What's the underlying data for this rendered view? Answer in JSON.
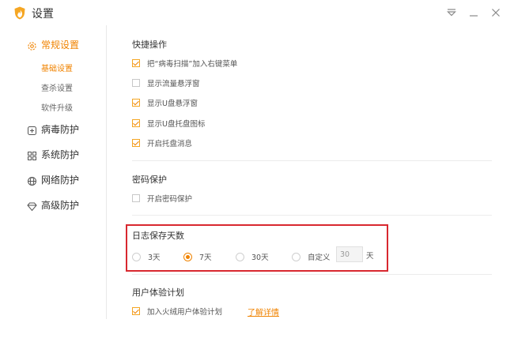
{
  "window": {
    "title": "设置",
    "controls": [
      "dropdown-icon",
      "minimize-icon",
      "close-icon"
    ]
  },
  "sidebar": {
    "items": [
      {
        "label": "常规设置",
        "icon": "gear-icon",
        "active": true,
        "subitems": [
          {
            "label": "基础设置",
            "active": true
          },
          {
            "label": "查杀设置",
            "active": false
          },
          {
            "label": "软件升级",
            "active": false
          }
        ]
      },
      {
        "label": "病毒防护",
        "icon": "plus-shield-icon",
        "active": false
      },
      {
        "label": "系统防护",
        "icon": "grid-icon",
        "active": false
      },
      {
        "label": "网络防护",
        "icon": "globe-icon",
        "active": false
      },
      {
        "label": "高级防护",
        "icon": "diamond-icon",
        "active": false
      }
    ]
  },
  "sections": {
    "shortcuts": {
      "title": "快捷操作",
      "options": [
        {
          "label": "把“病毒扫描”加入右键菜单",
          "checked": true
        },
        {
          "label": "显示流量悬浮窗",
          "checked": false
        },
        {
          "label": "显示U盘悬浮窗",
          "checked": true
        },
        {
          "label": "显示U盘托盘图标",
          "checked": true
        },
        {
          "label": "开启托盘消息",
          "checked": true
        }
      ]
    },
    "password": {
      "title": "密码保护",
      "options": [
        {
          "label": "开启密码保护",
          "checked": false
        }
      ]
    },
    "log_days": {
      "title": "日志保存天数",
      "options": [
        {
          "label": "3天",
          "checked": false
        },
        {
          "label": "7天",
          "checked": true
        },
        {
          "label": "30天",
          "checked": false
        },
        {
          "label": "自定义",
          "checked": false
        }
      ],
      "custom_value": "30",
      "unit": "天"
    },
    "ux_plan": {
      "title": "用户体验计划",
      "options": [
        {
          "label": "加入火绒用户体验计划",
          "checked": true
        }
      ],
      "link": "了解详情"
    }
  },
  "colors": {
    "accent": "#f08300",
    "highlight_border": "#d8282f",
    "logo": "#f5a623"
  }
}
